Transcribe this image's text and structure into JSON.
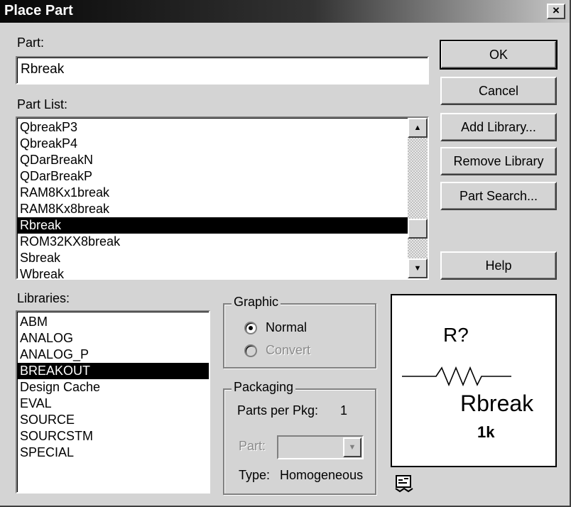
{
  "window": {
    "title": "Place Part",
    "close_label": "×"
  },
  "part": {
    "label": "Part:",
    "value": "Rbreak"
  },
  "part_list": {
    "label": "Part List:",
    "items": [
      "QbreakP3",
      "QbreakP4",
      "QDarBreakN",
      "QDarBreakP",
      "RAM8Kx1break",
      "RAM8Kx8break",
      "Rbreak",
      "ROM32KX8break",
      "Sbreak",
      "Wbreak"
    ],
    "selected_index": 6
  },
  "libraries": {
    "label": "Libraries:",
    "items": [
      "ABM",
      "ANALOG",
      "ANALOG_P",
      "BREAKOUT",
      "Design Cache",
      "EVAL",
      "SOURCE",
      "SOURCSTM",
      "SPECIAL"
    ],
    "selected_index": 3
  },
  "buttons": {
    "ok": "OK",
    "cancel": "Cancel",
    "add_library": "Add Library...",
    "remove_library": "Remove Library",
    "part_search": "Part Search...",
    "help": "Help"
  },
  "graphic": {
    "title": "Graphic",
    "normal": "Normal",
    "convert": "Convert",
    "selected": "Normal"
  },
  "packaging": {
    "title": "Packaging",
    "parts_per_pkg_label": "Parts per Pkg:",
    "parts_per_pkg_value": "1",
    "part_label": "Part:",
    "part_value": "",
    "type_label": "Type:",
    "type_value": "Homogeneous"
  },
  "preview": {
    "refdes": "R?",
    "value": "Rbreak",
    "param": "1k"
  },
  "icons": {
    "scroll_up": "up-arrow",
    "scroll_down": "down-arrow",
    "combo": "chevron-down",
    "library": "library-icon"
  }
}
